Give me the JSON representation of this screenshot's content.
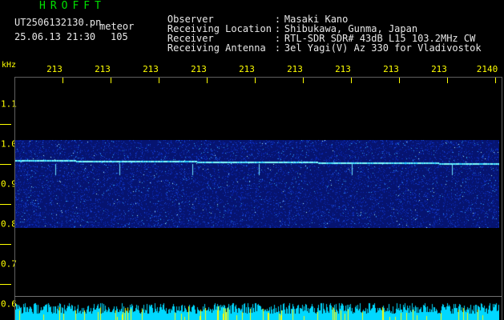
{
  "header": {
    "brand": "HROFFT",
    "file_name": "UT2506132130.pn",
    "tag": "meteor",
    "datetime": "25.06.13 21:30",
    "count": "105"
  },
  "info": [
    {
      "key": "Observer",
      "value": "Masaki Kano"
    },
    {
      "key": "Receiving Location",
      "value": "Shibukawa, Gunma, Japan"
    },
    {
      "key": "Receiver",
      "value": "RTL-SDR SDR# 43dB L15 103.2MHz CW"
    },
    {
      "key": "Receiving Antenna",
      "value": "3el Yagi(V) Az 330 for Vladivostok"
    }
  ],
  "axis": {
    "unit_label": "kHz",
    "x_ticks": [
      "213",
      "213",
      "213",
      "213",
      "213",
      "213",
      "213",
      "213",
      "213",
      "2140"
    ],
    "y_ticks": [
      "1.1",
      "1.0",
      "0.9",
      "0.8",
      "0.7",
      "0.6"
    ]
  },
  "colors": {
    "brand": "#00e000",
    "axis": "#ffff00",
    "signal_low": "#0a1a9c",
    "signal_high": "#00ffff",
    "activity": "#00d8ff",
    "burst": "#ffff00"
  }
}
